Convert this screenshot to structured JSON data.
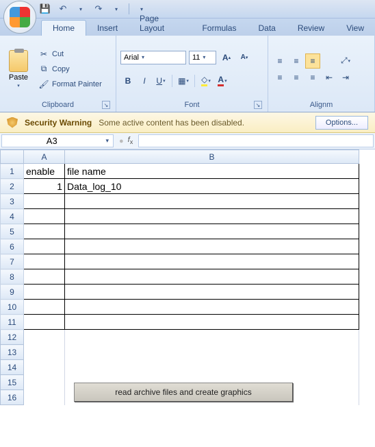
{
  "qat": {
    "save": "save",
    "undo": "undo",
    "redo": "redo"
  },
  "tabs": [
    "Home",
    "Insert",
    "Page Layout",
    "Formulas",
    "Data",
    "Review",
    "View"
  ],
  "active_tab": 0,
  "clipboard": {
    "paste": "Paste",
    "cut": "Cut",
    "copy": "Copy",
    "format_painter": "Format Painter",
    "group_label": "Clipboard"
  },
  "font": {
    "name": "Arial",
    "size": "11",
    "group_label": "Font"
  },
  "alignment": {
    "group_label": "Alignm"
  },
  "security": {
    "title": "Security Warning",
    "message": "Some active content has been disabled.",
    "options": "Options..."
  },
  "namebox": "A3",
  "formula": "",
  "columns": [
    "A",
    "B"
  ],
  "rows": [
    {
      "r": 1,
      "A": "enable",
      "B": "file name",
      "bordered": true
    },
    {
      "r": 2,
      "A": "1",
      "B": "Data_log_10",
      "bordered": true,
      "A_align": "right"
    },
    {
      "r": 3,
      "A": "",
      "B": "",
      "bordered": true
    },
    {
      "r": 4,
      "A": "",
      "B": "",
      "bordered": true
    },
    {
      "r": 5,
      "A": "",
      "B": "",
      "bordered": true
    },
    {
      "r": 6,
      "A": "",
      "B": "",
      "bordered": true
    },
    {
      "r": 7,
      "A": "",
      "B": "",
      "bordered": true
    },
    {
      "r": 8,
      "A": "",
      "B": "",
      "bordered": true
    },
    {
      "r": 9,
      "A": "",
      "B": "",
      "bordered": true
    },
    {
      "r": 10,
      "A": "",
      "B": "",
      "bordered": true
    },
    {
      "r": 11,
      "A": "",
      "B": "",
      "bordered": true
    },
    {
      "r": 12,
      "A": "",
      "B": "",
      "bordered": false
    },
    {
      "r": 13,
      "A": "",
      "B": "",
      "bordered": false
    },
    {
      "r": 14,
      "A": "",
      "B": "",
      "bordered": false
    },
    {
      "r": 15,
      "A": "",
      "B": "",
      "bordered": false
    },
    {
      "r": 16,
      "A": "",
      "B": "",
      "bordered": false
    }
  ],
  "embedded_button": "read archive files and create graphics"
}
